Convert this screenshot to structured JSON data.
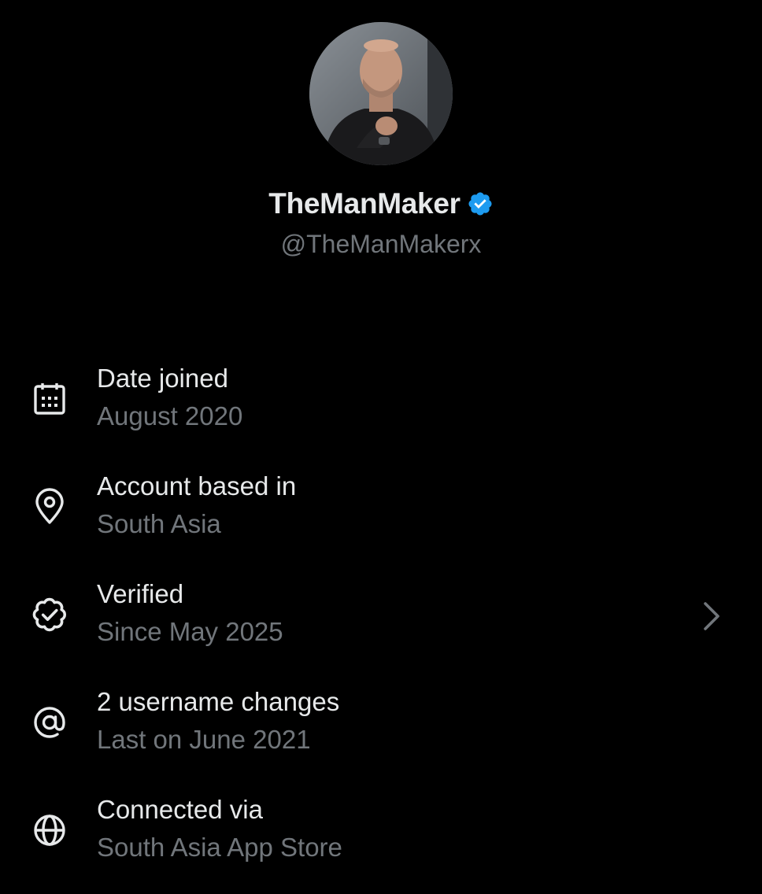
{
  "profile": {
    "display_name": "TheManMaker",
    "handle": "@TheManMakerx",
    "verified": true
  },
  "info_items": [
    {
      "icon": "calendar-icon",
      "title": "Date joined",
      "subtitle": "August 2020"
    },
    {
      "icon": "location-pin-icon",
      "title": "Account based in",
      "subtitle": "South Asia"
    },
    {
      "icon": "verified-badge-icon",
      "title": "Verified",
      "subtitle": "Since May 2025",
      "has_chevron": true
    },
    {
      "icon": "at-sign-icon",
      "title": "2 username changes",
      "subtitle": "Last on June 2021"
    },
    {
      "icon": "globe-icon",
      "title": "Connected via",
      "subtitle": "South Asia App Store"
    }
  ],
  "colors": {
    "background": "#000000",
    "primary_text": "#e7e9ea",
    "secondary_text": "#71767b",
    "verified_blue": "#1d9bf0"
  }
}
